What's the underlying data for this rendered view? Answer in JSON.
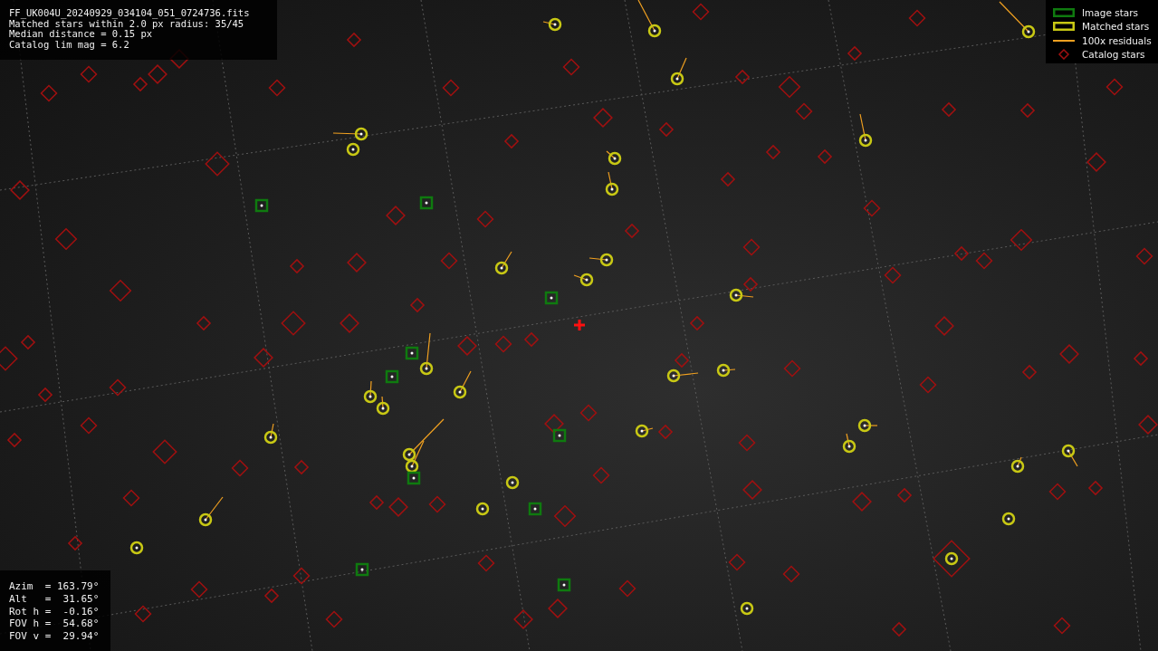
{
  "info": {
    "lines": [
      "FF_UK004U_20240929_034104_051_0724736.fits",
      "Matched stars within 2.0 px radius: 35/45",
      "Median distance = 0.15 px",
      "Catalog lim mag = 6.2"
    ]
  },
  "legend": [
    {
      "kind": "box",
      "label": "Image stars",
      "color": "#0f7a0f"
    },
    {
      "kind": "box",
      "label": "Matched stars",
      "color": "#c8c814"
    },
    {
      "kind": "line",
      "label": "100x residuals",
      "color": "#f0a020"
    },
    {
      "kind": "diamond",
      "label": "Catalog stars",
      "color": "#a01010"
    }
  ],
  "pointing": {
    "lines": [
      "Azim  = 163.79°",
      "Alt   =  31.65°",
      "Rot h =  -0.16°",
      "FOV h =  54.68°",
      "FOV v =  29.94°"
    ]
  }
}
